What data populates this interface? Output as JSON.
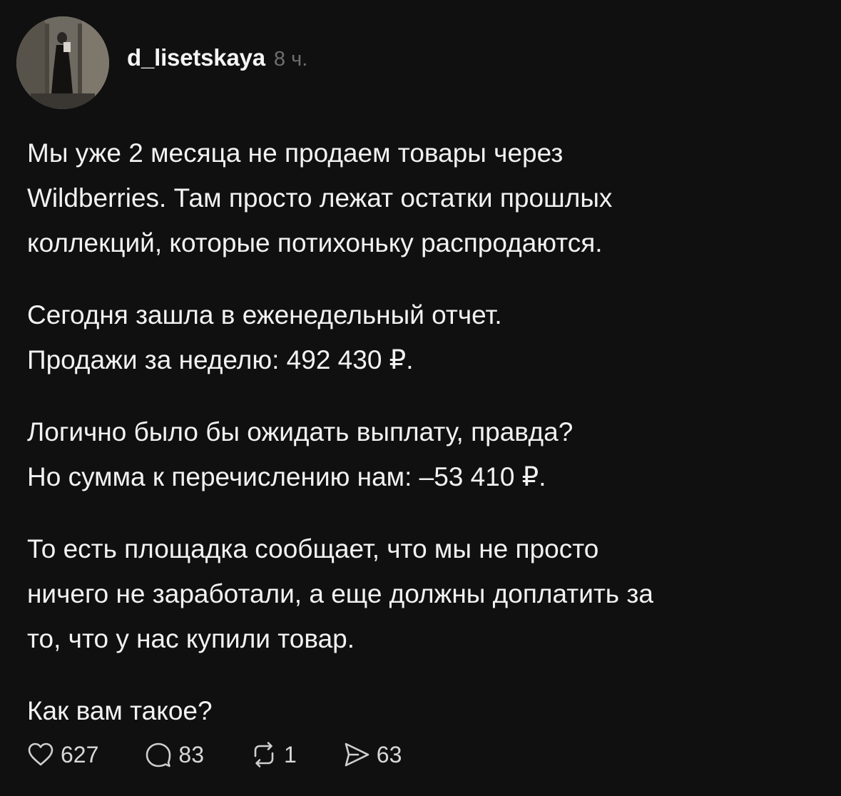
{
  "post": {
    "username": "d_lisetskaya",
    "timestamp": "8 ч.",
    "paragraphs": [
      "Мы уже 2 месяца не продаем товары через\nWildberries. Там просто лежат остатки прошлых\nколлекций, которые потихоньку распродаются.",
      "Сегодня зашла в еженедельный отчет.\nПродажи за неделю: 492 430 ₽.",
      "Логично было бы ожидать выплату, правда?\nНо сумма к перечислению нам: –53 410 ₽.",
      "То есть площадка сообщает, что мы не просто\nничего не заработали, а еще должны доплатить за\nто, что у нас купили товар.",
      "Как вам такое?"
    ]
  },
  "actions": {
    "likes": {
      "icon": "heart-icon",
      "count": "627"
    },
    "comments": {
      "icon": "comment-icon",
      "count": "83"
    },
    "reposts": {
      "icon": "repost-icon",
      "count": "1"
    },
    "shares": {
      "icon": "send-icon",
      "count": "63"
    }
  },
  "colors": {
    "background": "#101010",
    "text": "#f2f2f2",
    "muted": "#6e6e6e"
  }
}
